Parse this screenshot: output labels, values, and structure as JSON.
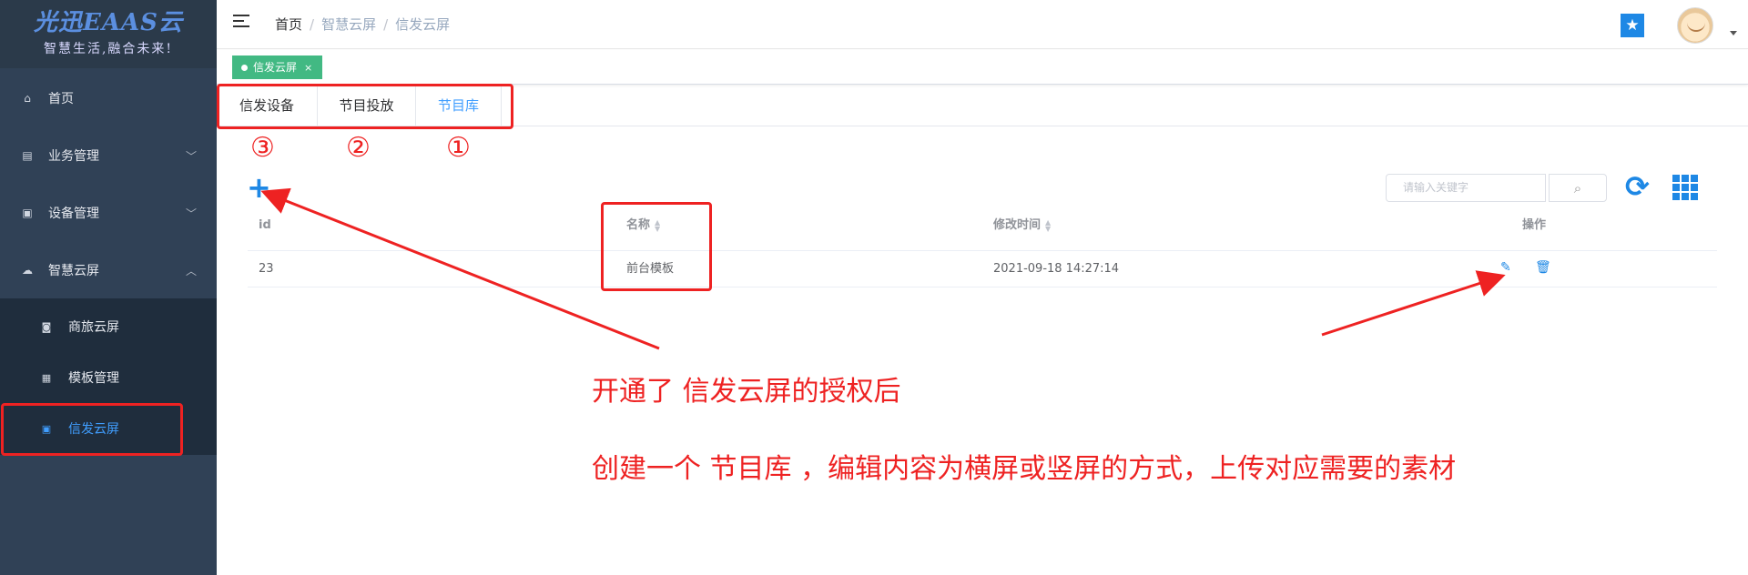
{
  "logo": {
    "title": "光迅EAAS云",
    "slogan": "智慧生活,融合未来!"
  },
  "sidebar": {
    "items": [
      {
        "label": "首页",
        "icon": "home-icon"
      },
      {
        "label": "业务管理",
        "icon": "list-icon"
      },
      {
        "label": "设备管理",
        "icon": "monitor-icon"
      },
      {
        "label": "智慧云屏",
        "icon": "cloud-icon"
      }
    ],
    "subitems": [
      {
        "label": "商旅云屏",
        "icon": "screen-icon"
      },
      {
        "label": "模板管理",
        "icon": "template-icon"
      },
      {
        "label": "信发云屏",
        "icon": "monitor-icon",
        "active": true
      }
    ]
  },
  "breadcrumb": {
    "home": "首页",
    "level2": "智慧云屏",
    "level3": "信发云屏",
    "sep": "/"
  },
  "tags": {
    "active_tag": "信发云屏",
    "close": "×"
  },
  "tabs": [
    {
      "label": "信发设备"
    },
    {
      "label": "节目投放"
    },
    {
      "label": "节目库",
      "active": true
    }
  ],
  "annotations": {
    "num3": "③",
    "num2": "②",
    "num1": "①",
    "line1": "开通了 信发云屏的授权后",
    "line2": "创建一个  节目库   ，编辑内容为横屏或竖屏的方式，上传对应需要的素材"
  },
  "toolbar": {
    "add": "+",
    "search_placeholder": "请输入关键字"
  },
  "table": {
    "headers": {
      "id": "id",
      "name": "名称",
      "modified": "修改时间",
      "ops": "操作"
    },
    "rows": [
      {
        "id": "23",
        "name": "前台模板",
        "modified": "2021-09-18 14:27:14"
      }
    ]
  },
  "colors": {
    "sidebar_bg": "#304156",
    "accent": "#409eff",
    "tag_green": "#42b983",
    "annotation_red": "#ee2222"
  }
}
